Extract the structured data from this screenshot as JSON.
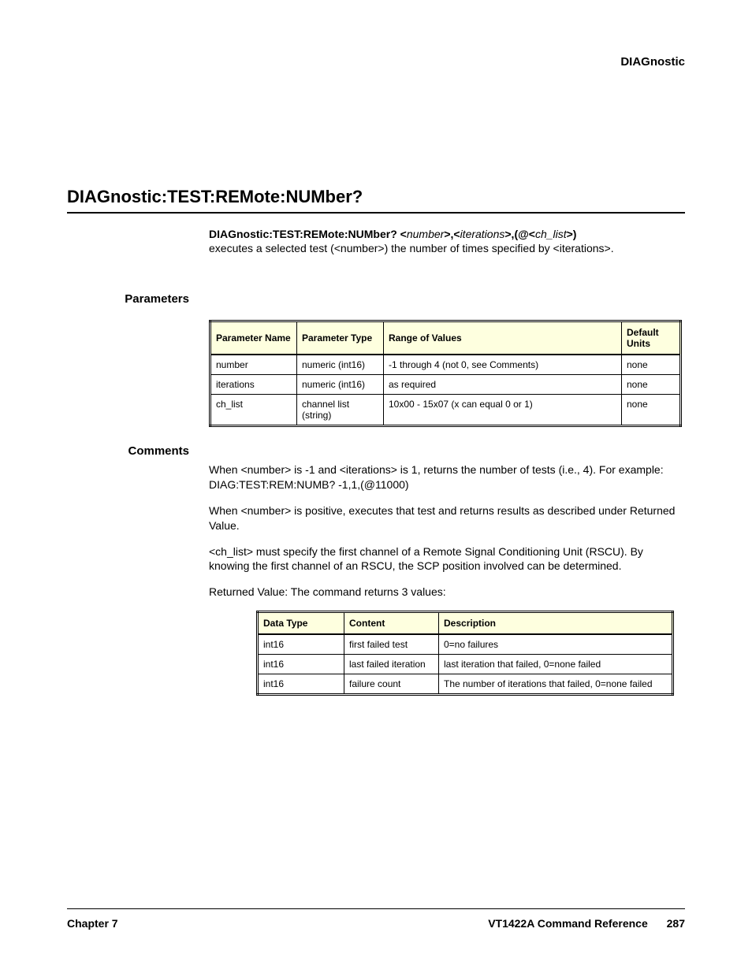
{
  "header": {
    "right": "DIAGnostic"
  },
  "section": {
    "title": "DIAGnostic:TEST:REMote:NUMber?"
  },
  "syntax": {
    "cmd_bold": "DIAGnostic:TEST:REMote:NUMber?  <",
    "p1": "number",
    "sep1": ">,<",
    "p2": "iterations",
    "sep2": ">,(@<",
    "p3": "ch_list",
    "end": ">)",
    "line2": "executes a selected test (<number>) the number of times specified by <iterations>."
  },
  "params": {
    "heading": "Parameters",
    "headers": [
      "Parameter Name",
      "Parameter Type",
      "Range of Values",
      "Default Units"
    ],
    "rows": [
      [
        "number",
        "numeric (int16)",
        "-1 through 4 (not 0, see Comments)",
        "none"
      ],
      [
        "iterations",
        "numeric (int16)",
        "as required",
        "none"
      ],
      [
        "ch_list",
        "channel list (string)",
        "10x00 - 15x07 (x can equal 0 or 1)",
        "none"
      ]
    ]
  },
  "comments": {
    "heading": "Comments",
    "lines": [
      "When <number> is -1 and <iterations> is 1, returns the number of tests (i.e., 4). For example: DIAG:TEST:REM:NUMB? -1,1,(@11000)",
      "When <number> is positive, executes that test and returns results as described under Returned Value.",
      "<ch_list> must specify the first channel of a Remote Signal Conditioning Unit (RSCU). By knowing the first channel of an RSCU, the SCP position involved can be determined."
    ]
  },
  "returned": {
    "intro": "Returned Value: The command returns 3 values:",
    "headers": [
      "Data Type",
      "Content",
      "Description"
    ],
    "rows": [
      [
        "int16",
        "first failed test",
        "0=no failures"
      ],
      [
        "int16",
        "last failed iteration",
        "last iteration that failed, 0=none failed"
      ],
      [
        "int16",
        "failure count",
        "The number of iterations that failed, 0=none failed"
      ]
    ]
  },
  "footer": {
    "left": "Chapter 7",
    "right": "VT1422A Command Reference",
    "page": "287"
  }
}
